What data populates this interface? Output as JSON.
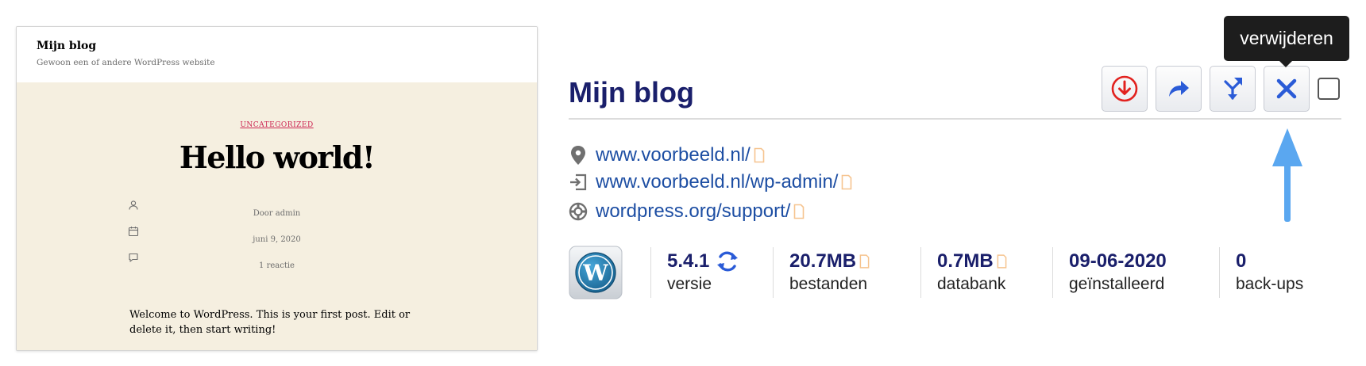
{
  "preview": {
    "site_title": "Mijn blog",
    "tagline": "Gewoon een of andere WordPress website",
    "category": "UNCATEGORIZED",
    "post_title": "Hello world!",
    "author": "Door admin",
    "date": "juni 9, 2020",
    "comments": "1 reactie",
    "excerpt": "Welcome to WordPress. This is your first post. Edit or delete it, then start writing!"
  },
  "site": {
    "title": "Mijn blog"
  },
  "tooltip": "verwijderen",
  "actions": [
    {
      "icon": "download-icon"
    },
    {
      "icon": "share-icon"
    },
    {
      "icon": "merge-icon"
    },
    {
      "icon": "close-icon"
    }
  ],
  "links": [
    {
      "icon": "location-pin-icon",
      "text": "www.voorbeeld.nl/"
    },
    {
      "icon": "login-icon",
      "text": "www.voorbeeld.nl/wp-admin/"
    },
    {
      "icon": "support-lifebuoy-icon",
      "text": "wordpress.org/support/"
    }
  ],
  "stats": {
    "version": {
      "value": "5.4.1",
      "label": "versie"
    },
    "files": {
      "value": "20.7MB",
      "label": "bestanden"
    },
    "database": {
      "value": "0.7MB",
      "label": "databank"
    },
    "installed": {
      "value": "09-06-2020",
      "label": "geïnstalleerd"
    },
    "backups": {
      "value": "0",
      "label": "back-ups"
    }
  },
  "colors": {
    "title": "#1a1f6b",
    "link": "#1d4ea3",
    "accent_blue": "#2a5bd7",
    "download_red": "#e2221f",
    "pointer_arrow": "#5aa7f0",
    "external_icon": "#f6c48f"
  }
}
